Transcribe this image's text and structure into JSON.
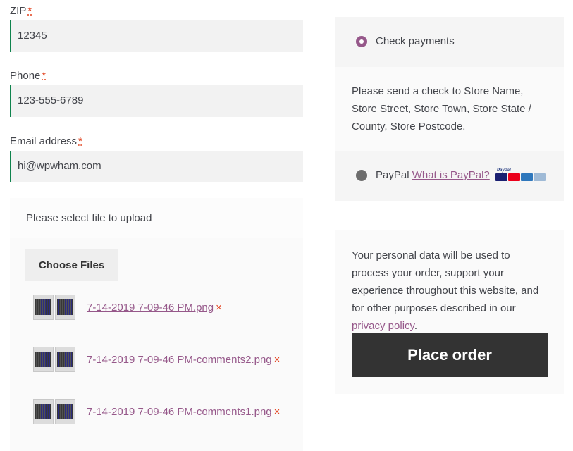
{
  "form": {
    "zip": {
      "label": "ZIP",
      "required": "*",
      "value": "12345"
    },
    "phone": {
      "label": "Phone",
      "required": "*",
      "value": "123-555-6789"
    },
    "email": {
      "label": "Email address",
      "required": "*",
      "value": "hi@wpwham.com"
    }
  },
  "upload": {
    "prompt": "Please select file to upload",
    "button_label": "Choose Files",
    "remove_glyph": "×",
    "files": [
      {
        "name": "7-14-2019 7-09-46 PM.png"
      },
      {
        "name": "7-14-2019 7-09-46 PM-comments2.png"
      },
      {
        "name": "7-14-2019 7-09-46 PM-comments1.png"
      }
    ]
  },
  "payment": {
    "check": {
      "label": "Check payments",
      "selected": true,
      "description": "Please send a check to Store Name, Store Street, Store Town, Store State / County, Store Postcode."
    },
    "paypal": {
      "label": "PayPal",
      "link": "What is PayPal?",
      "selected": false,
      "logo_text": "PayPal",
      "card_icons": [
        "visa-icon",
        "mastercard-icon",
        "amex-icon",
        "discover-icon"
      ]
    }
  },
  "privacy": {
    "text": "Your personal data will be used to process your order, support your experience throughout this website, and for other purposes described in our ",
    "link": "privacy policy",
    "suffix": "."
  },
  "place_order_label": "Place order",
  "colors": {
    "accent": "#96588a",
    "field_border": "#0f834d",
    "button_dark": "#333333",
    "required": "#e2401c"
  }
}
